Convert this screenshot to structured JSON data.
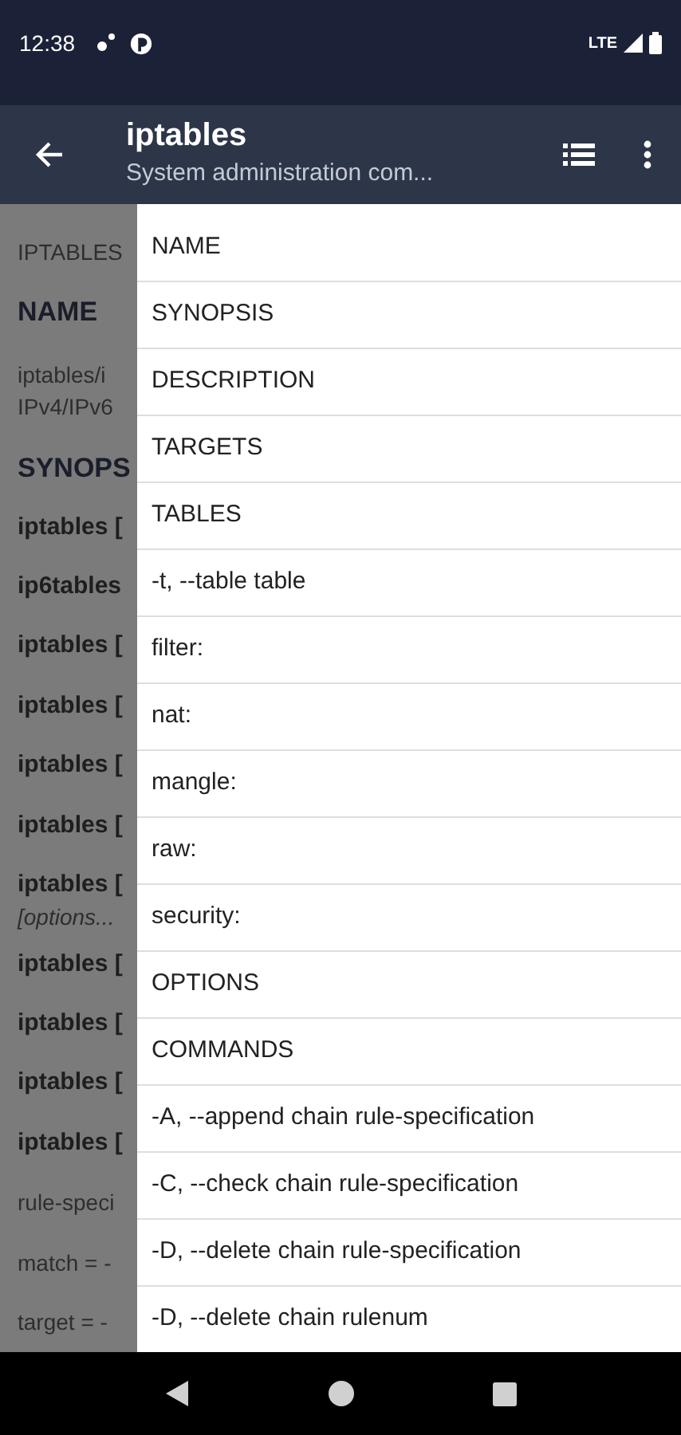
{
  "status_bar": {
    "time": "12:38",
    "network": "LTE"
  },
  "app_bar": {
    "title": "iptables",
    "subtitle": "System administration com..."
  },
  "page": [
    {
      "kind": "label",
      "text": "IPTABLES"
    },
    {
      "kind": "heading",
      "text": "NAME"
    },
    {
      "kind": "para",
      "text": "iptables/i"
    },
    {
      "kind": "para",
      "text": "IPv4/IPv6"
    },
    {
      "kind": "heading",
      "text": "SYNOPS"
    },
    {
      "kind": "command",
      "text": "iptables ["
    },
    {
      "kind": "command",
      "text": "ip6tables"
    },
    {
      "kind": "command",
      "text": "iptables ["
    },
    {
      "kind": "command",
      "text": "iptables ["
    },
    {
      "kind": "command",
      "text": "iptables ["
    },
    {
      "kind": "command",
      "text": "iptables ["
    },
    {
      "kind": "command",
      "text": "iptables ["
    },
    {
      "kind": "italic",
      "text": "[options..."
    },
    {
      "kind": "command",
      "text": "iptables ["
    },
    {
      "kind": "command",
      "text": "iptables ["
    },
    {
      "kind": "command",
      "text": "iptables ["
    },
    {
      "kind": "command",
      "text": "iptables ["
    },
    {
      "kind": "para",
      "text": "rule-speci"
    },
    {
      "kind": "para",
      "text": "match = -"
    },
    {
      "kind": "para",
      "text": "target = -"
    }
  ],
  "drawer": {
    "items": [
      {
        "label": "NAME"
      },
      {
        "label": "SYNOPSIS"
      },
      {
        "label": "DESCRIPTION"
      },
      {
        "label": "TARGETS"
      },
      {
        "label": "TABLES"
      },
      {
        "label": "-t, --table table"
      },
      {
        "label": "filter:"
      },
      {
        "label": "nat:"
      },
      {
        "label": "mangle:"
      },
      {
        "label": "raw:"
      },
      {
        "label": "security:"
      },
      {
        "label": "OPTIONS"
      },
      {
        "label": "COMMANDS"
      },
      {
        "label": "-A, --append chain rule-specification"
      },
      {
        "label": "-C, --check chain rule-specification"
      },
      {
        "label": "-D, --delete chain rule-specification"
      },
      {
        "label": "-D, --delete chain rulenum"
      }
    ]
  }
}
